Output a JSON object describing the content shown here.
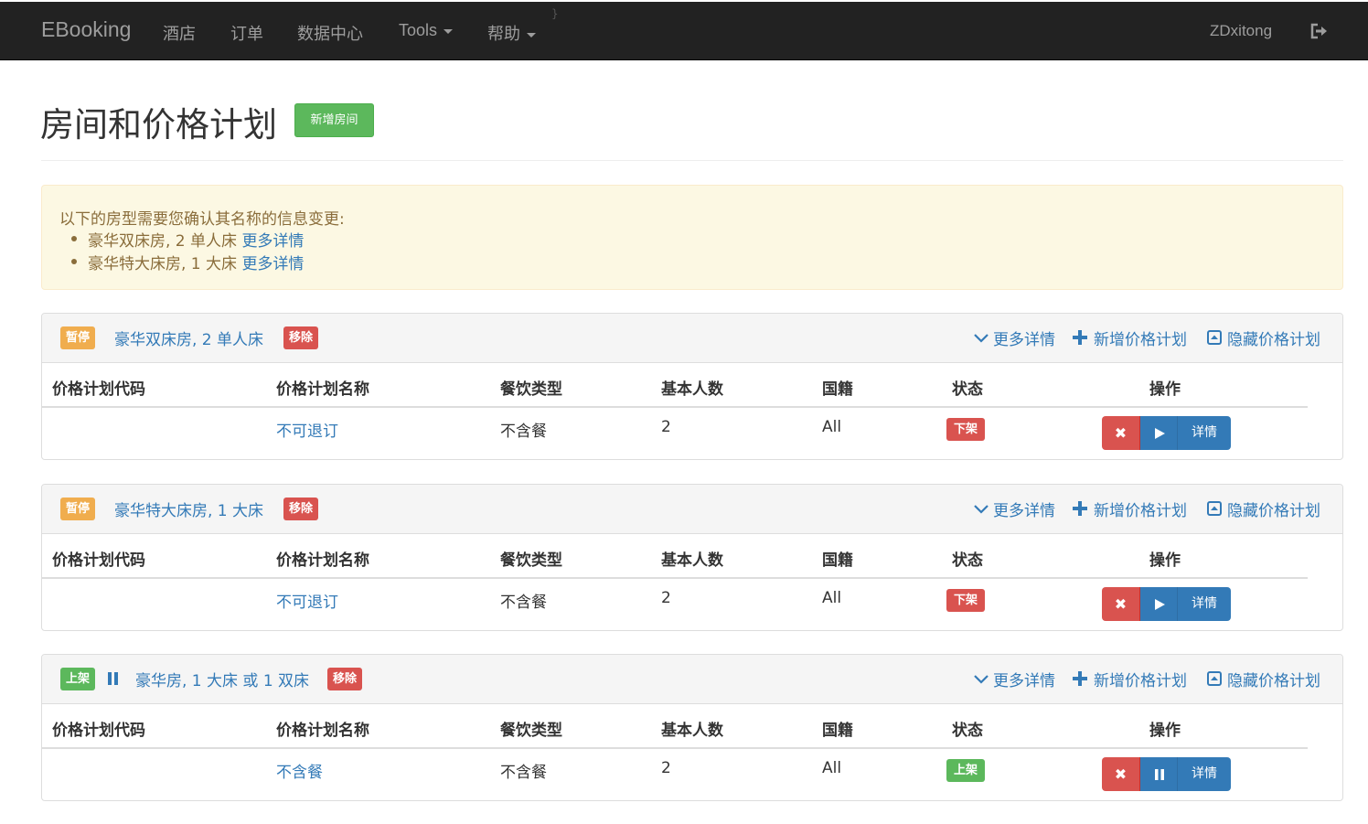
{
  "navbar": {
    "brand": "EBooking",
    "items": [
      "酒店",
      "订单",
      "数据中心",
      "Tools",
      "帮助"
    ],
    "stray": "}",
    "user": "ZDxitong"
  },
  "header": {
    "title": "房间和价格计划",
    "add_room": "新增房间"
  },
  "alert": {
    "intro": "以下的房型需要您确认其名称的信息变更:",
    "items": [
      {
        "text": "豪华双床房, 2 单人床 ",
        "link": "更多详情"
      },
      {
        "text": "豪华特大床房, 1 大床 ",
        "link": "更多详情"
      }
    ]
  },
  "panel_actions": {
    "more": "更多详情",
    "add_plan": "新增价格计划",
    "hide_plan": "隐藏价格计划"
  },
  "table_headers": [
    "价格计划代码",
    "价格计划名称",
    "餐饮类型",
    "基本人数",
    "国籍",
    "状态",
    "操作"
  ],
  "rooms": [
    {
      "status": "暂停",
      "name": "豪华双床房, 2 单人床",
      "remove": "移除",
      "plan": {
        "code": "",
        "name": "不可退订",
        "meal": "不含餐",
        "persons": "2",
        "nationality": "All",
        "status": "下架",
        "detail": "详情"
      }
    },
    {
      "status": "暂停",
      "name": "豪华特大床房, 1 大床",
      "remove": "移除",
      "plan": {
        "code": "",
        "name": "不可退订",
        "meal": "不含餐",
        "persons": "2",
        "nationality": "All",
        "status": "下架",
        "detail": "详情"
      }
    },
    {
      "status": "上架",
      "name": "豪华房, 1 大床 或 1 双床",
      "remove": "移除",
      "plan": {
        "code": "",
        "name": "不含餐",
        "meal": "不含餐",
        "persons": "2",
        "nationality": "All",
        "status": "上架",
        "detail": "详情"
      }
    }
  ],
  "colors": {
    "navbar_bg": "#222222",
    "link": "#337ab7",
    "success": "#5cb85c",
    "warning": "#f0ad4e",
    "danger": "#d9534f",
    "alert_bg": "#fcf8e3"
  }
}
